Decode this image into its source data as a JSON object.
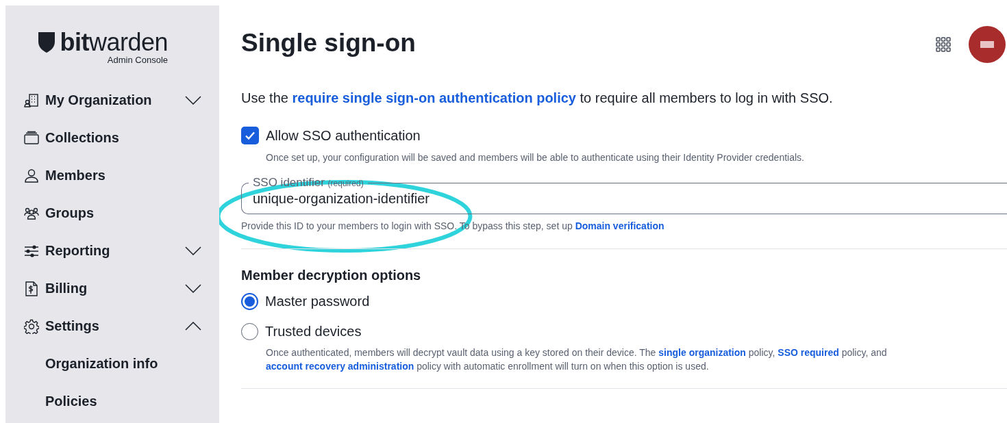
{
  "sidebar": {
    "logo": {
      "brand_bold": "bit",
      "brand_light": "warden",
      "subtitle": "Admin Console"
    },
    "items": [
      {
        "label": "My Organization",
        "expanded": false
      },
      {
        "label": "Collections"
      },
      {
        "label": "Members"
      },
      {
        "label": "Groups"
      },
      {
        "label": "Reporting",
        "expanded": false
      },
      {
        "label": "Billing",
        "expanded": false
      },
      {
        "label": "Settings",
        "expanded": true,
        "children": [
          {
            "label": "Organization info"
          },
          {
            "label": "Policies"
          }
        ]
      }
    ]
  },
  "page": {
    "title": "Single sign-on",
    "intro": [
      {
        "kind": "text",
        "text": "Use the "
      },
      {
        "kind": "link",
        "text": "require single sign-on authentication policy"
      },
      {
        "kind": "text",
        "text": " to require all members to log in with SSO."
      }
    ],
    "allow_sso": {
      "label": "Allow SSO authentication",
      "checked": true,
      "hint": "Once set up, your configuration will be saved and members will be able to authenticate using their Identity Provider credentials."
    },
    "sso_identifier": {
      "label": "SSO identifier",
      "note": "(required)",
      "value": "unique-organization-identifier",
      "help": [
        {
          "kind": "text",
          "text": "Provide this ID to your members to login with SSO. To bypass this step, set up "
        },
        {
          "kind": "link",
          "text": "Domain verification"
        }
      ]
    },
    "decryption": {
      "heading": "Member decryption options",
      "options": [
        {
          "label": "Master password",
          "selected": true
        },
        {
          "label": "Trusted devices",
          "selected": false
        }
      ],
      "description": [
        {
          "kind": "text",
          "text": "Once authenticated, members will decrypt vault data using a key stored on their device. The "
        },
        {
          "kind": "link",
          "text": "single organization"
        },
        {
          "kind": "text",
          "text": " policy, "
        },
        {
          "kind": "link",
          "text": "SSO required"
        },
        {
          "kind": "text",
          "text": " policy, and "
        },
        {
          "kind": "link",
          "text": "account recovery administration"
        },
        {
          "kind": "text",
          "text": " policy with automatic enrollment will turn on when this option is used."
        }
      ]
    }
  }
}
